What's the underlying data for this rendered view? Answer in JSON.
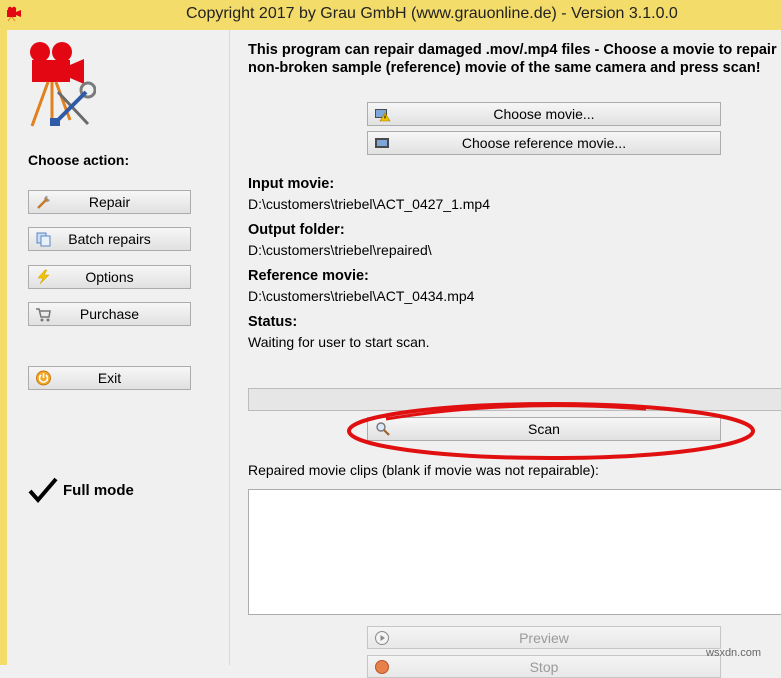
{
  "window": {
    "title": "Copyright 2017 by Grau GmbH (www.grauonline.de) - Version 3.1.0.0"
  },
  "sidebar": {
    "heading": "Choose action:",
    "buttons": [
      {
        "label": "Repair",
        "icon": "wrench-icon"
      },
      {
        "label": "Batch repairs",
        "icon": "copy-icon"
      },
      {
        "label": "Options",
        "icon": "lightning-icon"
      },
      {
        "label": "Purchase",
        "icon": "cart-icon"
      }
    ],
    "exit_label": "Exit",
    "exit_icon": "power-icon",
    "mode_label": "Full mode"
  },
  "main": {
    "instructions": "This program can repair damaged .mov/.mp4 files - Choose a movie to repair and a non-broken sample (reference) movie of the same camera and press scan!",
    "choose_movie_label": "Choose movie...",
    "choose_reference_label": "Choose reference movie...",
    "input_movie_label": "Input movie:",
    "input_movie_value": "D:\\customers\\triebel\\ACT_0427_1.mp4",
    "output_folder_label": "Output folder:",
    "output_folder_value": "D:\\customers\\triebel\\repaired\\",
    "reference_movie_label": "Reference movie:",
    "reference_movie_value": "D:\\customers\\triebel\\ACT_0434.mp4",
    "status_label": "Status:",
    "status_value": "Waiting for user to start scan.",
    "progress": 0,
    "scan_label": "Scan",
    "clips_label": "Repaired movie clips (blank if movie was not repairable):",
    "clips": [],
    "preview_label": "Preview",
    "stop_label": "Stop"
  },
  "watermark": "wsxdn.com",
  "colors": {
    "titlebar": "#f3dc6a",
    "highlight_ellipse": "#e01010",
    "logo_red": "#e30613"
  }
}
